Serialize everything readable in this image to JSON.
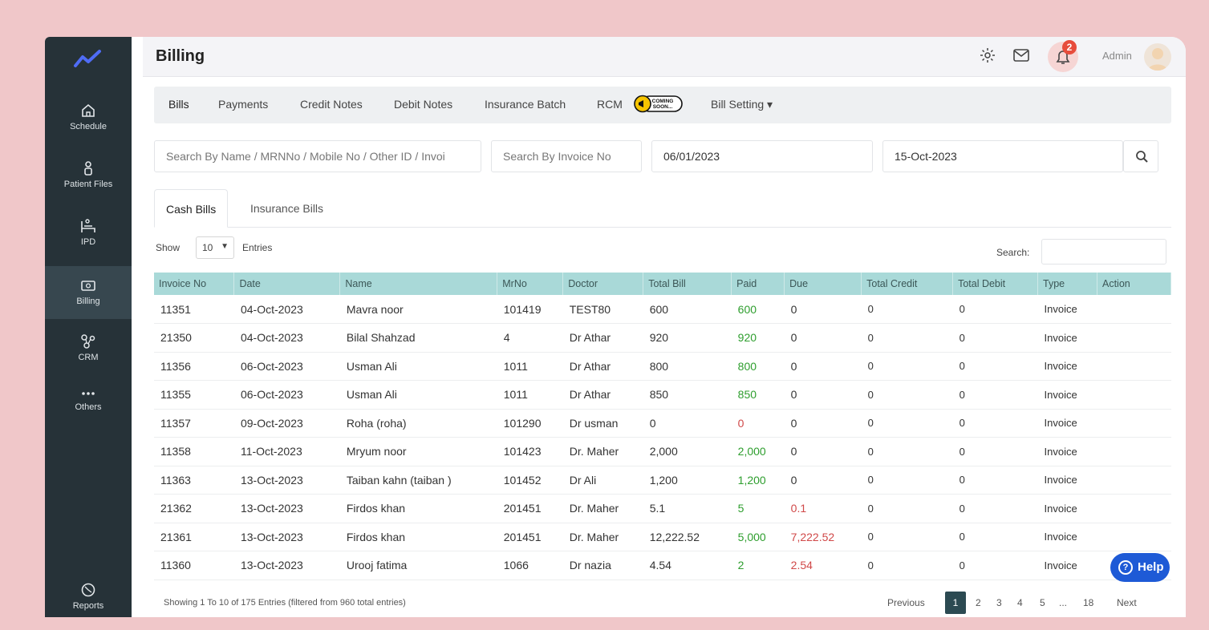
{
  "sidebar": {
    "items": [
      {
        "label": "Schedule"
      },
      {
        "label": "Patient Files"
      },
      {
        "label": "IPD"
      },
      {
        "label": "Billing"
      },
      {
        "label": "CRM"
      },
      {
        "label": "Others"
      },
      {
        "label": "Reports"
      }
    ]
  },
  "header": {
    "title": "Billing",
    "notification_count": "2",
    "user": "Admin"
  },
  "menu": {
    "items": [
      "Bills",
      "Payments",
      "Credit Notes",
      "Debit Notes",
      "Insurance Batch",
      "RCM",
      "Bill Setting ▾"
    ],
    "coming_soon": "COMING SOON..."
  },
  "filters": {
    "search_placeholder": "Search By Name / MRNNo / Mobile No / Other ID / Invoi",
    "invoice_placeholder": "Search By Invoice No",
    "date_from": "06/01/2023",
    "date_to": "15-Oct-2023"
  },
  "subtabs": [
    "Cash Bills",
    "Insurance Bills"
  ],
  "table_controls": {
    "show_label": "Show",
    "page_size": "10",
    "entries_label": "Entries",
    "search_label": "Search:"
  },
  "table": {
    "columns": [
      "Invoice No",
      "Date",
      "Name",
      "MrNo",
      "Doctor",
      "Total Bill",
      "Paid",
      "Due",
      "Total Credit",
      "Total Debit",
      "Type",
      "Action"
    ],
    "rows": [
      [
        "11351",
        "04-Oct-2023",
        "Mavra noor",
        "101419",
        "TEST80",
        "600",
        "600",
        "0",
        "0",
        "0",
        "Invoice",
        ""
      ],
      [
        "21350",
        "04-Oct-2023",
        "Bilal Shahzad",
        "4",
        "Dr Athar",
        "920",
        "920",
        "0",
        "0",
        "0",
        "Invoice",
        ""
      ],
      [
        "11356",
        "06-Oct-2023",
        "Usman Ali",
        "1011",
        "Dr Athar",
        "800",
        "800",
        "0",
        "0",
        "0",
        "Invoice",
        ""
      ],
      [
        "11355",
        "06-Oct-2023",
        "Usman Ali",
        "1011",
        "Dr Athar",
        "850",
        "850",
        "0",
        "0",
        "0",
        "Invoice",
        ""
      ],
      [
        "11357",
        "09-Oct-2023",
        "Roha (roha)",
        "101290",
        "Dr usman",
        "0",
        "0",
        "0",
        "0",
        "0",
        "Invoice",
        ""
      ],
      [
        "11358",
        "11-Oct-2023",
        "Mryum noor",
        "101423",
        "Dr. Maher",
        "2,000",
        "2,000",
        "0",
        "0",
        "0",
        "Invoice",
        ""
      ],
      [
        "11363",
        "13-Oct-2023",
        "Taiban kahn (taiban )",
        "101452",
        "Dr Ali",
        "1,200",
        "1,200",
        "0",
        "0",
        "0",
        "Invoice",
        ""
      ],
      [
        "21362",
        "13-Oct-2023",
        "Firdos khan",
        "201451",
        "Dr. Maher",
        "5.1",
        "5",
        "0.1",
        "0",
        "0",
        "Invoice",
        ""
      ],
      [
        "21361",
        "13-Oct-2023",
        "Firdos khan",
        "201451",
        "Dr. Maher",
        "12,222.52",
        "5,000",
        "7,222.52",
        "0",
        "0",
        "Invoice",
        ""
      ],
      [
        "11360",
        "13-Oct-2023",
        "Urooj fatima",
        "1066",
        "Dr nazia",
        "4.54",
        "2",
        "2.54",
        "0",
        "0",
        "Invoice",
        ""
      ]
    ],
    "paid_colors": [
      "green",
      "green",
      "green",
      "green",
      "red",
      "green",
      "green",
      "green",
      "green",
      "green"
    ],
    "due_colors": [
      "",
      "",
      "",
      "",
      "",
      "",
      "",
      "red",
      "red",
      "red"
    ]
  },
  "footer": {
    "info": "Showing 1 To 10 of 175 Entries (filtered from 960 total entries)",
    "pagination": [
      "Previous",
      "1",
      "2",
      "3",
      "4",
      "5",
      "...",
      "18",
      "Next"
    ],
    "active_page": "1"
  },
  "help": {
    "label": "Help"
  },
  "colors": {
    "sidebar": "#263238",
    "table_header": "#a9d9d8",
    "help": "#1e5ad6",
    "green": "#2e9e2e",
    "red": "#d04848"
  }
}
